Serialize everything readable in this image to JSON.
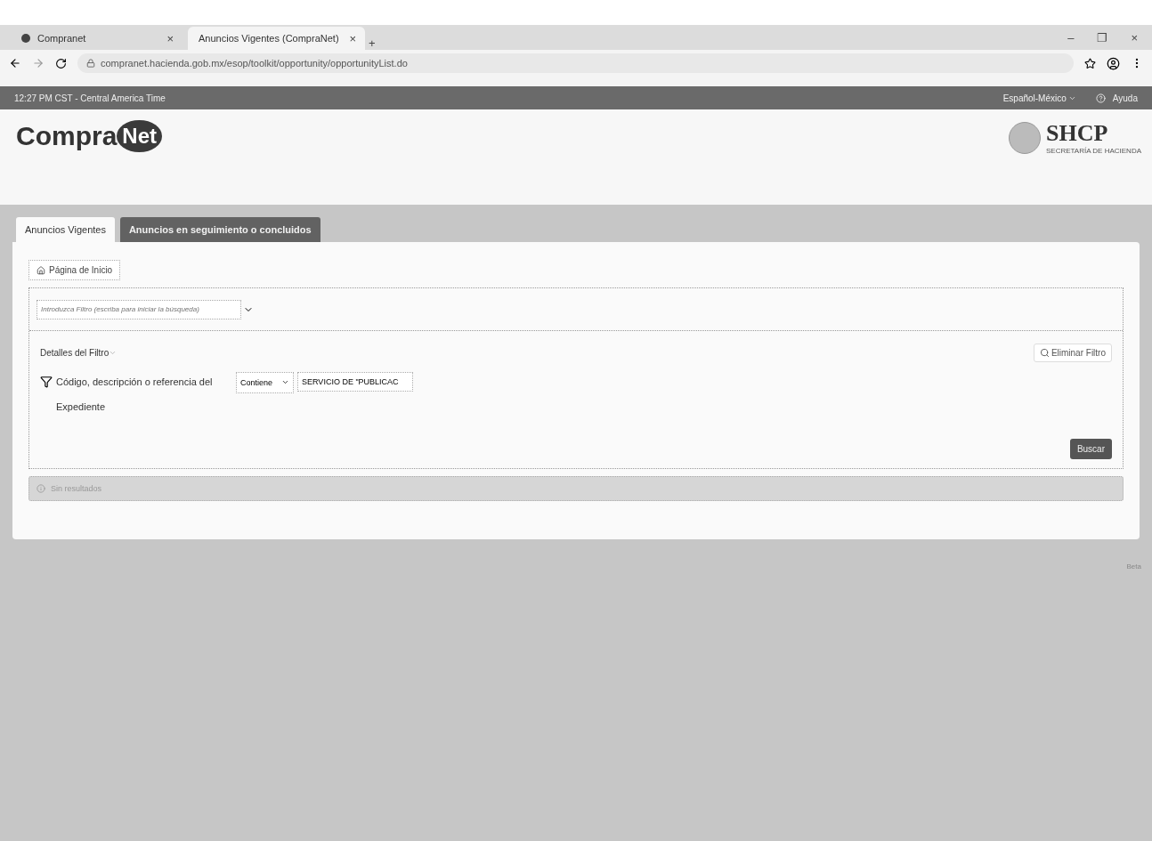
{
  "browser": {
    "tabs": [
      {
        "label": "Compranet",
        "selected": false,
        "close": "×"
      },
      {
        "label": "Anuncios Vigentes (CompraNet)",
        "selected": true,
        "close": "×"
      }
    ],
    "new_tab": "+",
    "url": "compranet.hacienda.gob.mx/esop/toolkit/opportunity/opportunityList.do",
    "window_controls": [
      "–",
      "❐",
      "×"
    ]
  },
  "topbar": {
    "time": "12:27 PM CST - Central America Time",
    "language": "Español-México",
    "help": "Ayuda"
  },
  "logo": {
    "left_a": "Compra",
    "left_b": "Net",
    "right": "SHCP",
    "right_sub": "SECRETARÍA DE HACIENDA"
  },
  "tabs": [
    {
      "label": "Anuncios Vigentes",
      "selected": true
    },
    {
      "label": "Anuncios en seguimiento o concluidos",
      "selected": false
    }
  ],
  "home_button": "Página de Inicio",
  "filter_select": {
    "placeholder": "Introduzca Filtro (escriba para iniciar la búsqueda)"
  },
  "filter_details": {
    "title": "Detalles del Filtro",
    "remove_button": "Eliminar Filtro",
    "criterion_label": "Código, descripción o referencia del Expediente",
    "operator": "Contiene",
    "value": "SERVICIO DE \"PUBLICAC",
    "search_button": "Buscar"
  },
  "results": {
    "message": "Sin resultados"
  },
  "footer": {
    "right": "Beta"
  }
}
